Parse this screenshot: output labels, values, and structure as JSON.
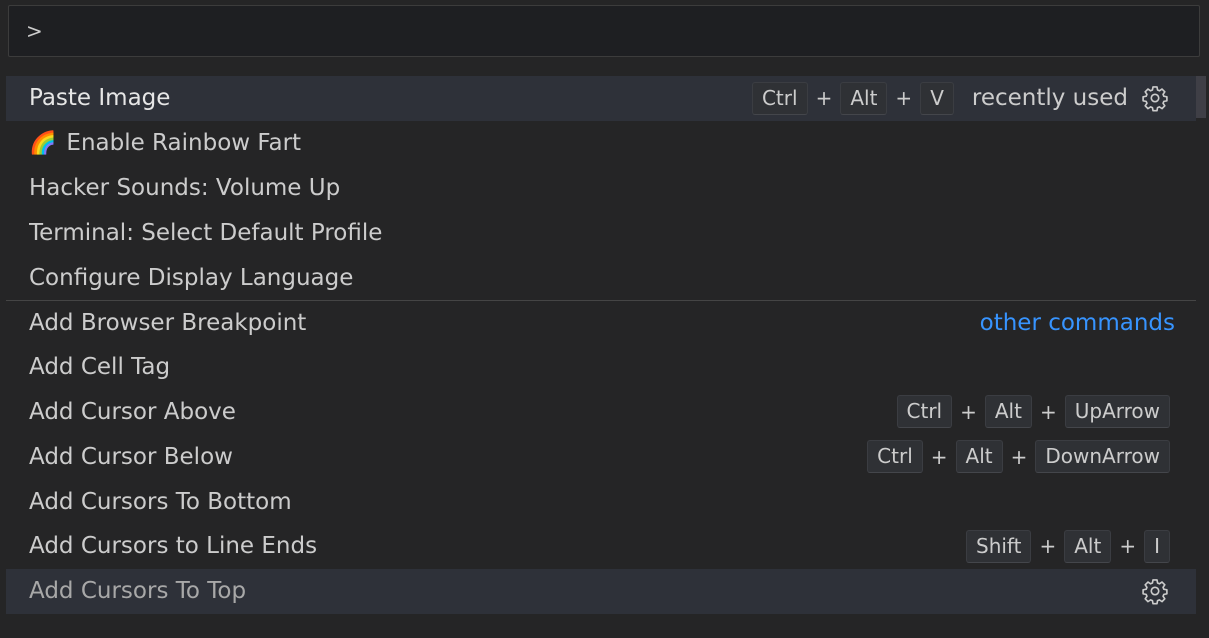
{
  "input": {
    "value": ">"
  },
  "items": [
    {
      "label": "Paste Image",
      "keys": [
        "Ctrl",
        "Alt",
        "V"
      ],
      "description": "recently used",
      "gear": true
    },
    {
      "label": "Enable Rainbow Fart",
      "emoji": "🌈"
    },
    {
      "label": "Hacker Sounds: Volume Up"
    },
    {
      "label": "Terminal: Select Default Profile"
    },
    {
      "label": "Configure Display Language"
    },
    {
      "label": "Add Browser Breakpoint",
      "group_label": "other commands"
    },
    {
      "label": "Add Cell Tag"
    },
    {
      "label": "Add Cursor Above",
      "keys": [
        "Ctrl",
        "Alt",
        "UpArrow"
      ]
    },
    {
      "label": "Add Cursor Below",
      "keys": [
        "Ctrl",
        "Alt",
        "DownArrow"
      ]
    },
    {
      "label": "Add Cursors To Bottom"
    },
    {
      "label": "Add Cursors to Line Ends",
      "keys": [
        "Shift",
        "Alt",
        "I"
      ]
    },
    {
      "label": "Add Cursors To Top",
      "gear": true
    }
  ],
  "plus_sign": "+",
  "colors": {
    "accent": "#3794ff",
    "background": "#252526",
    "active_row": "#2e3139"
  },
  "icons": {
    "gear": "gear-icon",
    "emoji": "rainbow-emoji"
  }
}
